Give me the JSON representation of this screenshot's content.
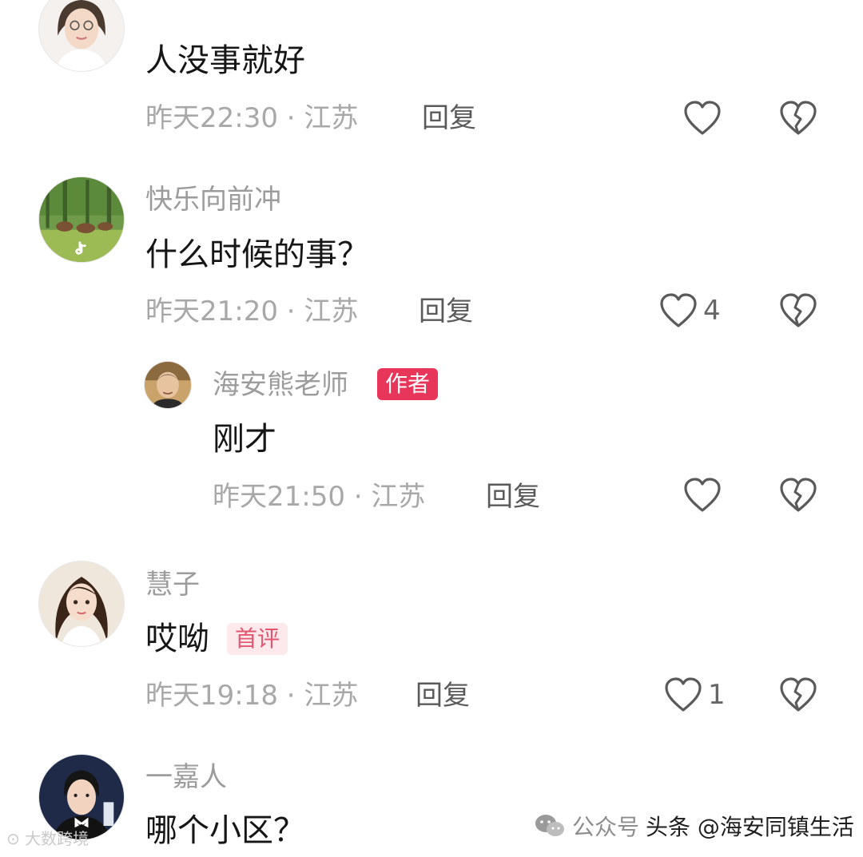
{
  "comments": [
    {
      "username": "",
      "text": "人没事就好",
      "meta": "昨天22:30 · 江苏",
      "reply_label": "回复",
      "likes": ""
    },
    {
      "username": "快乐向前冲",
      "text": "什么时候的事？",
      "meta": "昨天21:20 · 江苏",
      "reply_label": "回复",
      "likes": "4",
      "replies": [
        {
          "username": "海安熊老师",
          "badge": "作者",
          "text": "刚才",
          "meta": "昨天21:50 · 江苏",
          "reply_label": "回复",
          "likes": ""
        }
      ]
    },
    {
      "username": "慧子",
      "text": "哎呦",
      "badge": "首评",
      "meta": "昨天19:18 · 江苏",
      "reply_label": "回复",
      "likes": "1"
    },
    {
      "username": "一嘉人",
      "text": "哪个小区？"
    }
  ],
  "watermarks": {
    "left": "大数跨境",
    "wechat": "公众号",
    "toutiao": "头条 @海安同镇生活"
  },
  "icons": {
    "like": "heart-outline-icon",
    "dislike": "broken-heart-icon"
  },
  "colors": {
    "author_badge": "#e8365a",
    "first_badge_bg": "#fde8ec",
    "first_badge_text": "#e4566f"
  }
}
